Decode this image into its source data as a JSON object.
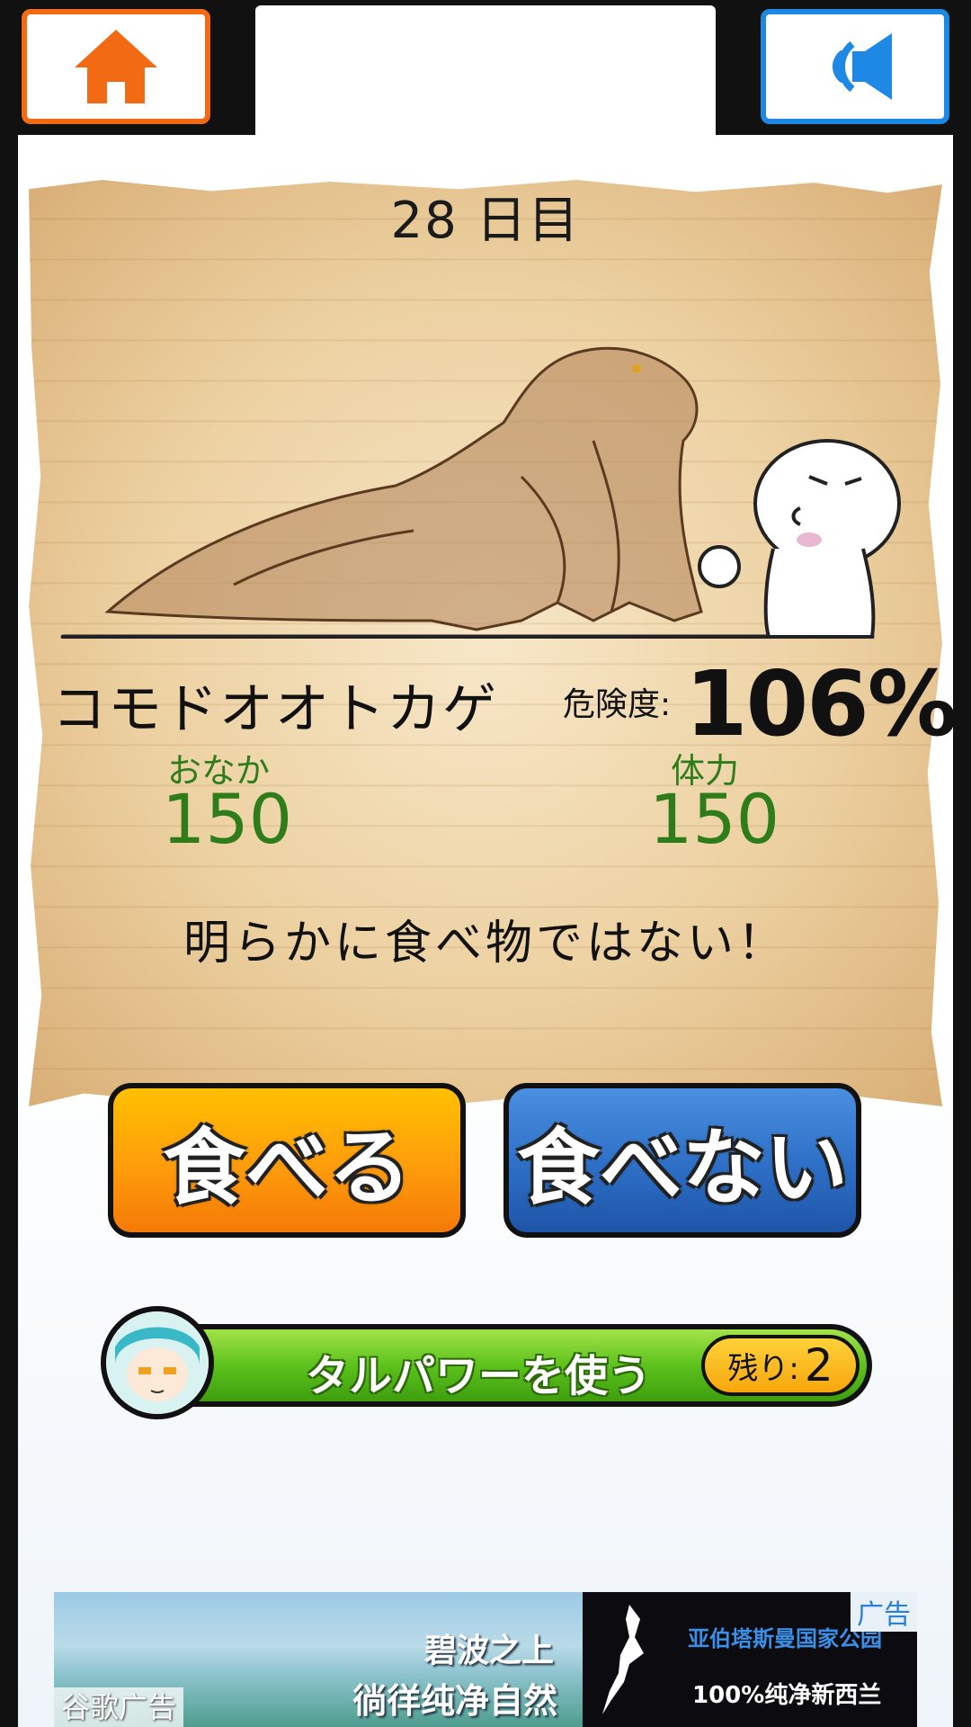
{
  "header": {
    "home_icon": "home-icon",
    "sound_icon": "sound-speaker-icon",
    "colors": {
      "home": "#f26b14",
      "sound": "#1e88e5"
    }
  },
  "card": {
    "day_label": "28 日目",
    "creature_name": "コモドオオトカゲ",
    "danger_label": "危険度:",
    "danger_value": "106%",
    "stats": [
      {
        "label": "おなか",
        "value": "150"
      },
      {
        "label": "体力",
        "value": "150"
      }
    ],
    "message": "明らかに食べ物ではない！"
  },
  "actions": {
    "eat_label": "食べる",
    "not_eat_label": "食べない"
  },
  "power": {
    "label": "タルパワーを使う",
    "remaining_label": "残り:",
    "remaining_value": "2"
  },
  "ad": {
    "line1": "碧波之上",
    "line2": "徜徉纯净自然",
    "line3": "亚伯塔斯曼国家公园",
    "line4": "100%纯净新西兰",
    "badge": "广告",
    "google_label": "谷歌广告"
  }
}
